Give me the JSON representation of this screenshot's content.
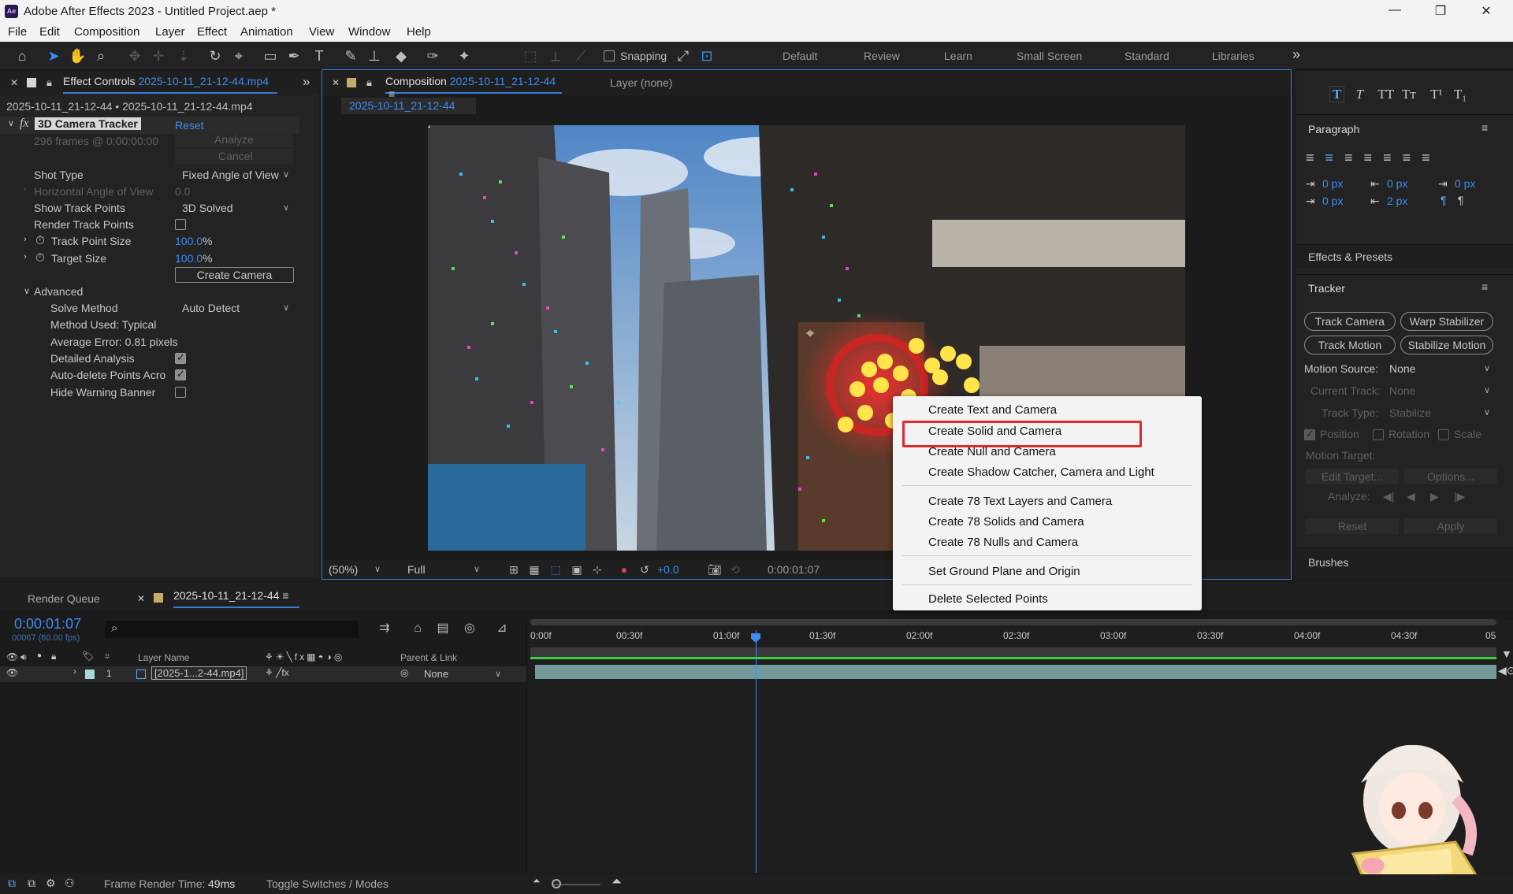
{
  "window": {
    "title": "Adobe After Effects 2023 - Untitled Project.aep *",
    "app_icon": "Ae",
    "controls": [
      "—",
      "❐",
      "✕"
    ]
  },
  "menu": [
    "File",
    "Edit",
    "Composition",
    "Layer",
    "Effect",
    "Animation",
    "View",
    "Window",
    "Help"
  ],
  "toolbar": {
    "snapping_label": "Snapping",
    "workspaces": [
      "Default",
      "Review",
      "Learn",
      "Small Screen",
      "Standard",
      "Libraries"
    ],
    "more_glyph": "»"
  },
  "effect_controls": {
    "tab_label": "Effect Controls",
    "tab_file": "2025-10-11_21-12-44.mp4",
    "breadcrumb": "2025-10-11_21-12-44 • 2025-10-11_21-12-44.mp4",
    "fx_label": "fx",
    "effect_name": "3D Camera Tracker",
    "reset": "Reset",
    "frames_info": "296 frames @ 0:00:00:00",
    "analyze": "Analyze",
    "cancel": "Cancel",
    "shot_type_label": "Shot Type",
    "shot_type_value": "Fixed Angle of View",
    "hfov_label": "Horizontal Angle of View",
    "hfov_value": "0.0",
    "show_track_points_label": "Show Track Points",
    "show_track_points_value": "3D Solved",
    "render_track_points_label": "Render Track Points",
    "track_point_size_label": "Track Point Size",
    "track_point_size_value": "100.0",
    "target_size_label": "Target Size",
    "target_size_value": "100.0",
    "percent": "%",
    "create_camera": "Create Camera",
    "advanced_label": "Advanced",
    "solve_method_label": "Solve Method",
    "solve_method_value": "Auto Detect",
    "method_used": "Method Used: Typical",
    "average_error": "Average Error: 0.81 pixels",
    "detailed_analysis_label": "Detailed Analysis",
    "auto_delete_label": "Auto-delete Points Acro",
    "hide_warning_label": "Hide Warning Banner"
  },
  "composition": {
    "tab_label": "Composition",
    "tab_name": "2025-10-11_21-12-44",
    "layer_label": "Layer",
    "layer_value": "(none)",
    "sub_tab": "2025-10-11_21-12-44",
    "zoom": "(50%)",
    "resolution": "Full",
    "exposure": "+0.0",
    "timecode": "0:00:01:07"
  },
  "context_menu": {
    "items": [
      "Create Text and Camera",
      "Create Solid and Camera",
      "Create Null and Camera",
      "Create Shadow Catcher, Camera and Light",
      "Create 78 Text Layers and Camera",
      "Create 78 Solids and Camera",
      "Create 78 Nulls and Camera",
      "Set Ground Plane and Origin",
      "Delete Selected Points"
    ],
    "highlighted_index": 1
  },
  "right_panel": {
    "char_styles": [
      "T",
      "T",
      "TT",
      "Tт",
      "T¹",
      "T₁"
    ],
    "paragraph_title": "Paragraph",
    "indent_values": [
      "0 px",
      "0 px",
      "0 px",
      "0 px",
      "2 px"
    ],
    "effects_presets_title": "Effects & Presets",
    "tracker_title": "Tracker",
    "track_camera": "Track Camera",
    "warp_stabilizer": "Warp Stabilizer",
    "track_motion": "Track Motion",
    "stabilize_motion": "Stabilize Motion",
    "motion_source_label": "Motion Source:",
    "motion_source_value": "None",
    "current_track_label": "Current Track:",
    "current_track_value": "None",
    "track_type_label": "Track Type:",
    "track_type_value": "Stabilize",
    "position_label": "Position",
    "rotation_label": "Rotation",
    "scale_label": "Scale",
    "motion_target_label": "Motion Target:",
    "edit_target": "Edit Target...",
    "options": "Options...",
    "analyze_label": "Analyze:",
    "reset": "Reset",
    "apply": "Apply",
    "brushes_title": "Brushes"
  },
  "timeline": {
    "render_queue_tab": "Render Queue",
    "comp_tab": "2025-10-11_21-12-44",
    "timecode": "0:00:01:07",
    "frame_info": "00067 (60.00 fps)",
    "search_icon_label": "⌕",
    "columns": {
      "hash": "#",
      "layer_name": "Layer Name",
      "parent_link": "Parent & Link"
    },
    "layer": {
      "index": "1",
      "name": "[2025-1...2-44.mp4]",
      "parent": "None"
    },
    "ruler": [
      "0:00f",
      "00:30f",
      "01:00f",
      "01:30f",
      "02:00f",
      "02:30f",
      "03:00f",
      "03:30f",
      "04:00f",
      "04:30f",
      "05"
    ],
    "playhead_fraction": 0.233,
    "frame_render_label": "Frame Render Time:",
    "frame_render_value": "49ms",
    "toggle_label": "Toggle Switches / Modes"
  },
  "colors": {
    "accent": "#3e8cf0",
    "highlight_box": "#e02a2a",
    "track_bar": "#8fc4c4",
    "work_area": "#3bd13b"
  }
}
